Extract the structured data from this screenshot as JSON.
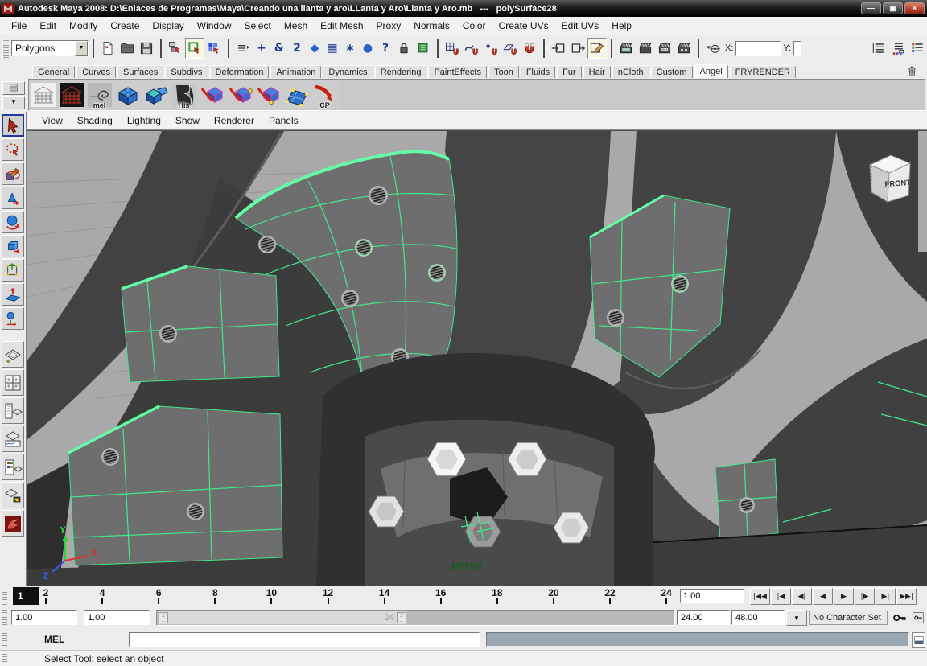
{
  "titlebar": {
    "title": "Autodesk Maya 2008: D:\\Enlaces de Programas\\Maya\\Creando una llanta y aro\\LLanta y Aro\\Llanta y Aro.mb   ---   polySurface28",
    "minimize": "—",
    "restore": "▣",
    "close": "×"
  },
  "menubar": {
    "items": [
      "File",
      "Edit",
      "Modify",
      "Create",
      "Display",
      "Window",
      "Select",
      "Mesh",
      "Edit Mesh",
      "Proxy",
      "Normals",
      "Color",
      "Create UVs",
      "Edit UVs",
      "Help"
    ]
  },
  "statusline": {
    "menu_set": "Polygons",
    "items": [
      {
        "t": "dropdown",
        "name": "menu-set-selector"
      },
      {
        "t": "sep"
      },
      {
        "t": "icon",
        "name": "new-scene-button",
        "sym": "page"
      },
      {
        "t": "icon",
        "name": "open-scene-button",
        "sym": "folder"
      },
      {
        "t": "icon",
        "name": "save-scene-button",
        "sym": "floppy"
      },
      {
        "t": "sep"
      },
      {
        "t": "icon",
        "name": "select-by-hierarchy-button",
        "sym": "selhier"
      },
      {
        "t": "icon",
        "name": "select-by-object-button",
        "sym": "selobj",
        "active": true
      },
      {
        "t": "icon",
        "name": "select-by-component-button",
        "sym": "selcomp"
      },
      {
        "t": "sep"
      },
      {
        "t": "icon",
        "name": "selection-mask-menu-button",
        "sym": "maskexp"
      },
      {
        "t": "glyph",
        "name": "mask-points-toggle",
        "g": "+",
        "c": "#20408f"
      },
      {
        "t": "glyph",
        "name": "mask-handles-toggle",
        "g": "&",
        "c": "#20408f"
      },
      {
        "t": "glyph",
        "name": "mask-curves-toggle",
        "g": "2",
        "c": "#20408f"
      },
      {
        "t": "glyph",
        "name": "mask-surfaces-toggle",
        "g": "◆",
        "c": "#2a62c8"
      },
      {
        "t": "glyph",
        "name": "mask-deformations-toggle",
        "g": "▦",
        "c": "#20408f"
      },
      {
        "t": "glyph",
        "name": "mask-dynamics-toggle",
        "g": "∗",
        "c": "#20408f"
      },
      {
        "t": "glyph",
        "name": "mask-rendering-toggle",
        "g": "●",
        "c": "#2a62c8"
      },
      {
        "t": "glyph",
        "name": "mask-misc-toggle",
        "g": "?",
        "c": "#20408f"
      },
      {
        "t": "icon",
        "name": "lock-selection-button",
        "sym": "lockic"
      },
      {
        "t": "icon",
        "name": "highlight-selection-button",
        "sym": "highlightic"
      },
      {
        "t": "sep"
      },
      {
        "t": "icon",
        "name": "snap-to-grids-button",
        "sym": "snapgrid"
      },
      {
        "t": "icon",
        "name": "snap-to-curves-button",
        "sym": "snapcurve"
      },
      {
        "t": "icon",
        "name": "snap-to-points-button",
        "sym": "snappoint"
      },
      {
        "t": "icon",
        "name": "snap-to-planes-button",
        "sym": "snapplane"
      },
      {
        "t": "icon",
        "name": "make-live-button",
        "sym": "magnet"
      },
      {
        "t": "sep"
      },
      {
        "t": "icon",
        "name": "input-connections-button",
        "sym": "inconn"
      },
      {
        "t": "icon",
        "name": "output-connections-button",
        "sym": "outconn"
      },
      {
        "t": "icon",
        "name": "construction-history-toggle",
        "sym": "history",
        "active": true
      },
      {
        "t": "sep"
      },
      {
        "t": "icon",
        "name": "open-render-view-button",
        "sym": "clapdark"
      },
      {
        "t": "icon",
        "name": "render-current-frame-button",
        "sym": "clap"
      },
      {
        "t": "icon",
        "name": "ipr-render-button",
        "sym": "clapipr"
      },
      {
        "t": "icon",
        "name": "render-settings-button",
        "sym": "clapset"
      },
      {
        "t": "sep"
      },
      {
        "t": "icon",
        "name": "input-field-mode-button",
        "sym": "targetdrop"
      },
      {
        "t": "label",
        "name": "x-coordinate-label",
        "text": "X:"
      },
      {
        "t": "input",
        "name": "x-coordinate-input",
        "value": "",
        "w": 56
      },
      {
        "t": "label",
        "name": "y-coordinate-label",
        "text": "Y:"
      },
      {
        "t": "input",
        "name": "y-coordinate-input",
        "value": "",
        "w": 10
      },
      {
        "t": "spring"
      },
      {
        "t": "icon",
        "name": "toggle-attribute-editor-button",
        "sym": "panelA"
      },
      {
        "t": "icon",
        "name": "toggle-tool-settings-button",
        "sym": "panelB"
      },
      {
        "t": "icon",
        "name": "toggle-channel-box-button",
        "sym": "panelC"
      }
    ]
  },
  "shelf": {
    "active_tab": "Angel",
    "tabs": [
      "General",
      "Curves",
      "Surfaces",
      "Subdivs",
      "Deformation",
      "Animation",
      "Dynamics",
      "Rendering",
      "PaintEffects",
      "Toon",
      "Fluids",
      "Fur",
      "Hair",
      "nCloth",
      "Custom",
      "Angel",
      "FRYRENDER"
    ],
    "items": [
      {
        "name": "shelf-item-architecture-outline",
        "sym": "archgray",
        "label": ""
      },
      {
        "name": "shelf-item-architecture-red",
        "sym": "archred",
        "label": ""
      },
      {
        "name": "shelf-item-mel-script",
        "sym": "melic",
        "label": "mel"
      },
      {
        "name": "shelf-item-poly-cube",
        "sym": "cube1",
        "label": ""
      },
      {
        "name": "shelf-item-poly-cubes",
        "sym": "cube2",
        "label": ""
      },
      {
        "name": "shelf-item-history",
        "sym": "hisic",
        "label": "His"
      },
      {
        "name": "shelf-item-component-arrow-1",
        "sym": "cubearrow",
        "label": ""
      },
      {
        "name": "shelf-item-component-arrow-2",
        "sym": "cubearrow2",
        "label": ""
      },
      {
        "name": "shelf-item-component-arrow-3",
        "sym": "cubearrow3",
        "label": ""
      },
      {
        "name": "shelf-item-plane-vertices",
        "sym": "planev",
        "label": ""
      },
      {
        "name": "shelf-item-cp",
        "sym": "cpic",
        "label": "CP"
      }
    ]
  },
  "toolbox": {
    "tools": [
      {
        "name": "select-tool",
        "sym": "cursor",
        "active": true
      },
      {
        "name": "lasso-select-tool",
        "sym": "lasso"
      },
      {
        "name": "paint-select-tool",
        "sym": "paint"
      },
      {
        "name": "move-tool",
        "sym": "move"
      },
      {
        "name": "rotate-tool",
        "sym": "rotate"
      },
      {
        "name": "scale-tool",
        "sym": "scale"
      },
      {
        "name": "universal-manipulator-tool",
        "sym": "universal"
      },
      {
        "name": "soft-modification-tool",
        "sym": "softmod"
      },
      {
        "name": "last-used-tool",
        "sym": "balltool"
      }
    ],
    "layouts": [
      {
        "name": "layout-single-perspective",
        "sym": "laysingle"
      },
      {
        "name": "layout-four-view",
        "sym": "layfour"
      },
      {
        "name": "layout-persp-outliner",
        "sym": "layoutliner"
      },
      {
        "name": "layout-persp-graph",
        "sym": "laygraph"
      },
      {
        "name": "layout-hypershade-persp",
        "sym": "layhyper"
      },
      {
        "name": "layout-persp-hypergraph",
        "sym": "layhg"
      },
      {
        "name": "fryrender-tool",
        "sym": "fry"
      }
    ]
  },
  "panel_menu": {
    "items": [
      "View",
      "Shading",
      "Lighting",
      "Show",
      "Renderer",
      "Panels"
    ]
  },
  "viewport": {
    "camera_label": "persp",
    "view_cube_label": "FRONT",
    "axis_x": "X",
    "axis_y": "Y",
    "axis_z": "Z"
  },
  "time_slider": {
    "ticks": [
      2,
      4,
      6,
      8,
      10,
      12,
      14,
      16,
      18,
      20,
      22,
      24
    ],
    "current_frame": "1",
    "current_time": "1.00",
    "playback": [
      {
        "name": "go-to-playback-start-button",
        "label": "|◀◀"
      },
      {
        "name": "step-back-frame-button",
        "label": "|◀"
      },
      {
        "name": "step-back-key-button",
        "label": "◀|"
      },
      {
        "name": "play-backwards-button",
        "label": "◀"
      },
      {
        "name": "play-forwards-button",
        "label": "▶"
      },
      {
        "name": "step-forward-key-button",
        "label": "|▶"
      },
      {
        "name": "step-forward-frame-button",
        "label": "▶|"
      },
      {
        "name": "go-to-playback-end-button",
        "label": "▶▶|"
      }
    ]
  },
  "range_slider": {
    "animation_start": "1.00",
    "playback_start": "1.00",
    "range_end_label": "24",
    "playback_end": "24.00",
    "animation_end": "48.00",
    "character_set": "No Character Set"
  },
  "command_line": {
    "label": "MEL",
    "input_value": "",
    "result_value": ""
  },
  "help_line": {
    "text": "Select Tool: select an object"
  },
  "colors": {
    "selection_green": "#41e98d",
    "selected_edge_green": "#63ffa8",
    "viewport_background": "#a9a9a9",
    "camera_label_green": "#1b5a20",
    "titlebar_background": "#0a0a0a"
  }
}
